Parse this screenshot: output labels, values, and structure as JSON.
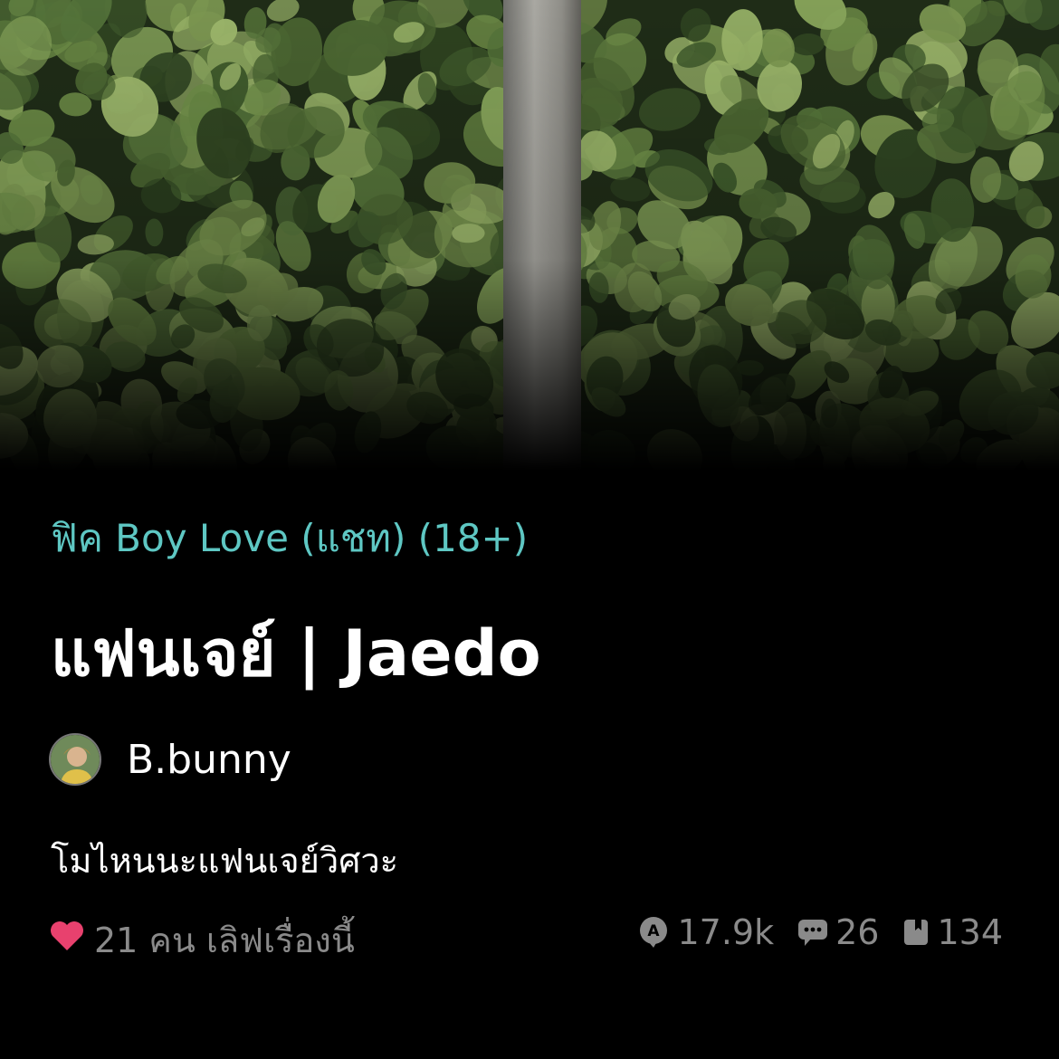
{
  "story": {
    "category": "ฟิค Boy Love (แชท) (18+)",
    "title": "แฟนเจย์ | Jaedo",
    "author": "B.bunny",
    "description": "โมไหนนะแฟนเจย์วิศวะ"
  },
  "likes": {
    "text": "21 คน เลิฟเรื่องนี้",
    "icon": "heart-icon",
    "color": "#e8416e"
  },
  "stats": {
    "reads": "17.9k",
    "comments": "26",
    "chapters": "134",
    "reads_icon": "reads-icon",
    "comments_icon": "chat-icon",
    "chapters_icon": "book-icon"
  },
  "colors": {
    "accent": "#5ec7c3",
    "background": "#000000",
    "muted": "#8a8a8a"
  }
}
